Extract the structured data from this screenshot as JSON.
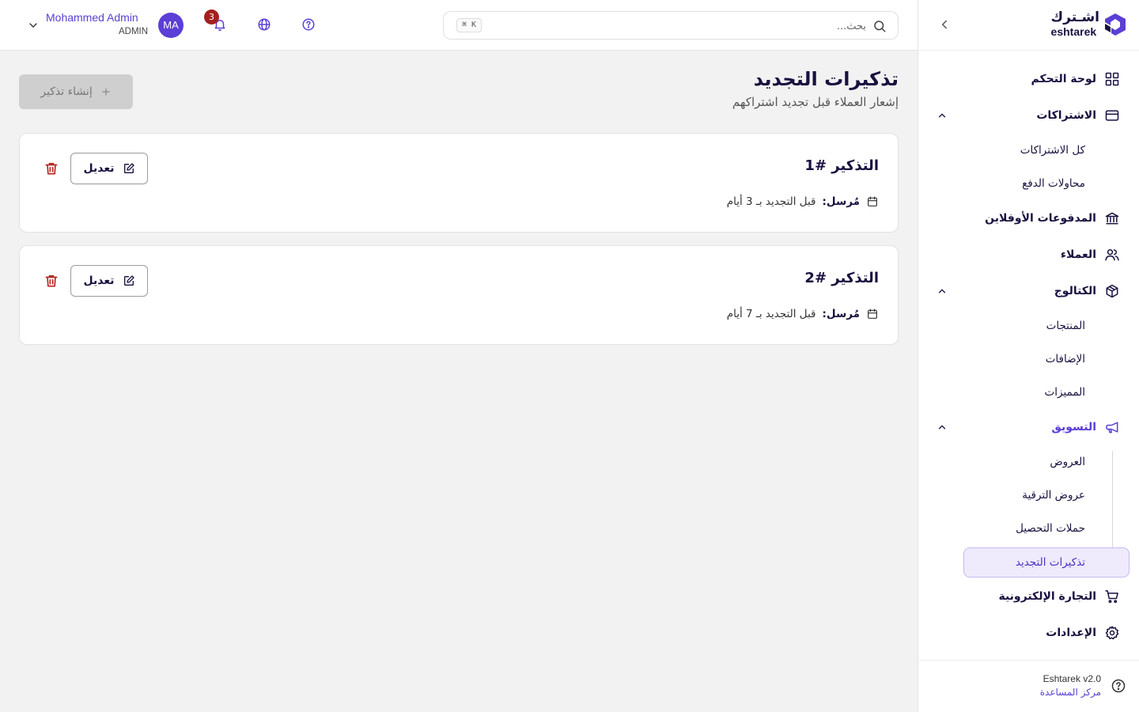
{
  "brand": {
    "name_ar": "اشـترك",
    "name_en": "eshtarek",
    "logo_color": "#5b3fd6"
  },
  "topbar": {
    "search_placeholder": "بحث...",
    "shortcut": "⌘ K",
    "notifications_count": "3",
    "user": {
      "initials": "MA",
      "name": "Mohammed Admin",
      "role": "ADMIN"
    }
  },
  "sidebar": {
    "items": [
      {
        "label": "لوحة التحكم",
        "icon": "dashboard-grid-icon"
      },
      {
        "label": "الاشتراكات",
        "icon": "credit-card-icon",
        "expanded": true,
        "children": [
          "كل الاشتراكات",
          "محاولات الدفع"
        ]
      },
      {
        "label": "المدفوعات الأوفلاين",
        "icon": "bank-icon"
      },
      {
        "label": "العملاء",
        "icon": "users-icon"
      },
      {
        "label": "الكتالوج",
        "icon": "package-icon",
        "expanded": true,
        "children": [
          "المنتجات",
          "الإضافات",
          "المميزات"
        ]
      },
      {
        "label": "التسويق",
        "icon": "megaphone-icon",
        "expanded": true,
        "active": true,
        "children": [
          "العروض",
          "عروض الترقية",
          "حملات التحصيل",
          "تذكيرات التجديد"
        ],
        "selected_child": "تذكيرات التجديد"
      },
      {
        "label": "التجارة الإلكترونية",
        "icon": "cart-icon"
      },
      {
        "label": "الإعدادات",
        "icon": "gear-icon"
      }
    ],
    "footer": {
      "version": "Eshtarek v2.0",
      "help_link": "مركز المساعدة"
    }
  },
  "page": {
    "title": "تذكيرات التجديد",
    "subtitle": "إشعار العملاء قبل تجديد اشتراكهم",
    "create_button": "إنشاء تذكير"
  },
  "reminders": [
    {
      "title": "التذكير #1",
      "meta_label": "مُرسل:",
      "meta_value": "قبل التجديد بـ 3 أيام",
      "edit_label": "تعديل"
    },
    {
      "title": "التذكير #2",
      "meta_label": "مُرسل:",
      "meta_value": "قبل التجديد بـ 7 أيام",
      "edit_label": "تعديل"
    }
  ],
  "colors": {
    "accent": "#5b3fd6",
    "danger": "#b3261e",
    "badge": "#a31f1f",
    "selected_bg": "#efeafc"
  }
}
